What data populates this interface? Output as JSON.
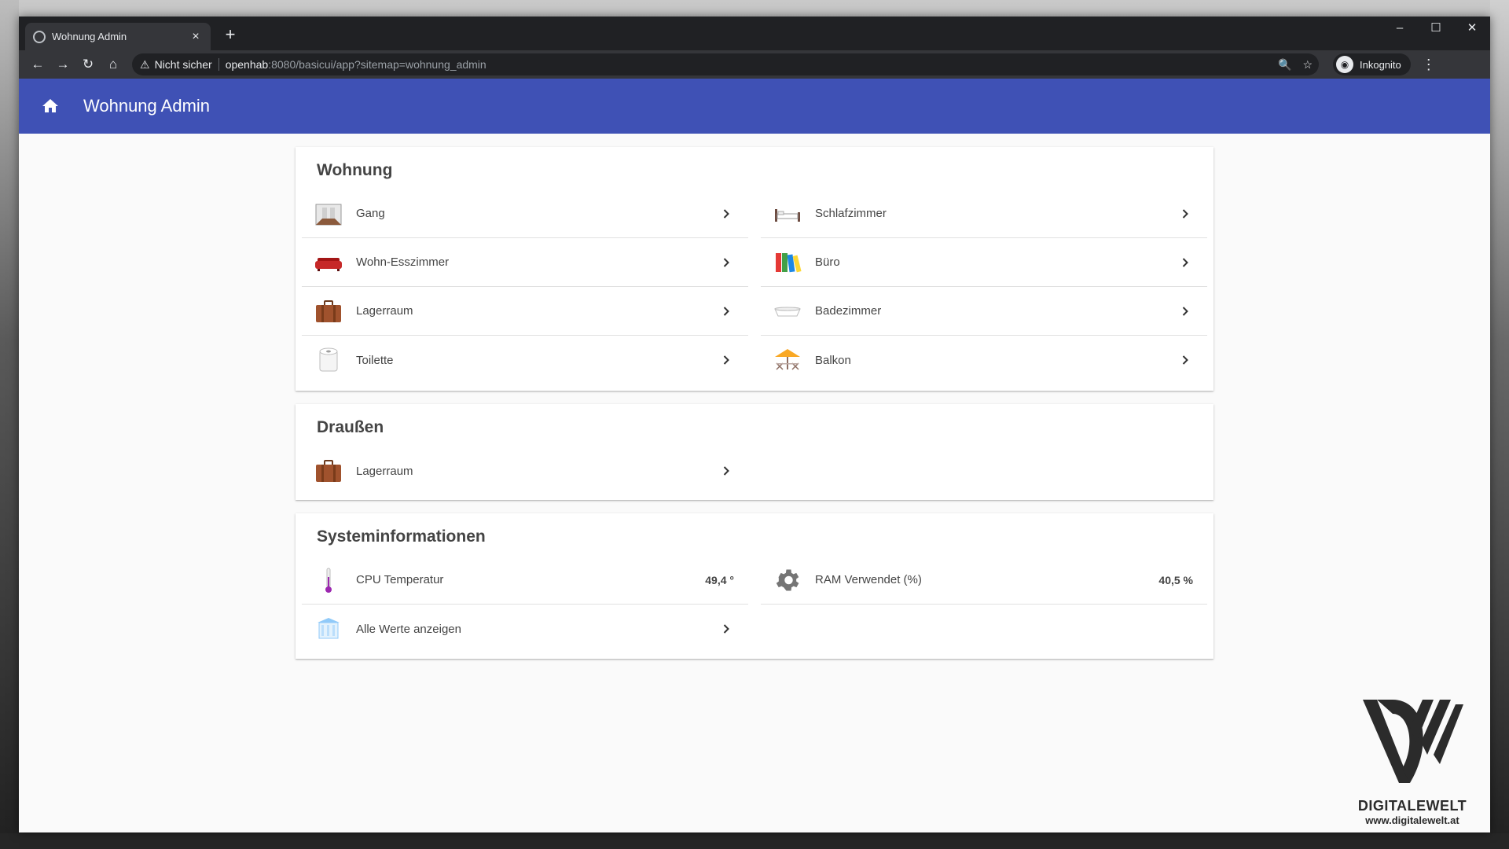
{
  "browser": {
    "tab_title": "Wohnung Admin",
    "tab_close": "×",
    "new_tab": "+",
    "window_controls": {
      "minimize": "–",
      "maximize": "☐",
      "close": "✕"
    },
    "nav": {
      "back": "←",
      "forward": "→",
      "reload": "↻",
      "home": "⌂"
    },
    "security_label": "Nicht sicher",
    "url_host": "openhab",
    "url_rest": ":8080/basicui/app?sitemap=wohnung_admin",
    "profile_label": "Inkognito",
    "zoom_icon": "🔍",
    "star_icon": "☆",
    "menu_icon": "⋮"
  },
  "app": {
    "title": "Wohnung Admin",
    "accent_color": "#3f51b5"
  },
  "sections": {
    "wohnung": {
      "title": "Wohnung",
      "items": [
        {
          "label": "Gang",
          "icon": "corridor-icon"
        },
        {
          "label": "Schlafzimmer",
          "icon": "bed-icon"
        },
        {
          "label": "Wohn-Esszimmer",
          "icon": "sofa-icon"
        },
        {
          "label": "Büro",
          "icon": "office-binders-icon"
        },
        {
          "label": "Lagerraum",
          "icon": "suitcase-icon"
        },
        {
          "label": "Badezimmer",
          "icon": "bathtub-icon"
        },
        {
          "label": "Toilette",
          "icon": "toilet-paper-icon"
        },
        {
          "label": "Balkon",
          "icon": "parasol-icon"
        }
      ]
    },
    "draussen": {
      "title": "Draußen",
      "items": [
        {
          "label": "Lagerraum",
          "icon": "suitcase-icon"
        }
      ]
    },
    "system": {
      "title": "Systeminformationen",
      "cpu": {
        "label": "CPU Temperatur",
        "value": "49,4 °",
        "icon": "thermometer-icon"
      },
      "ram": {
        "label": "RAM Verwendet (%)",
        "value": "40,5 %",
        "icon": "gear-icon"
      },
      "all": {
        "label": "Alle Werte anzeigen",
        "icon": "archive-icon"
      }
    }
  },
  "watermark": {
    "brand": "DIGITALEWELT",
    "url": "www.digitalewelt.at"
  }
}
